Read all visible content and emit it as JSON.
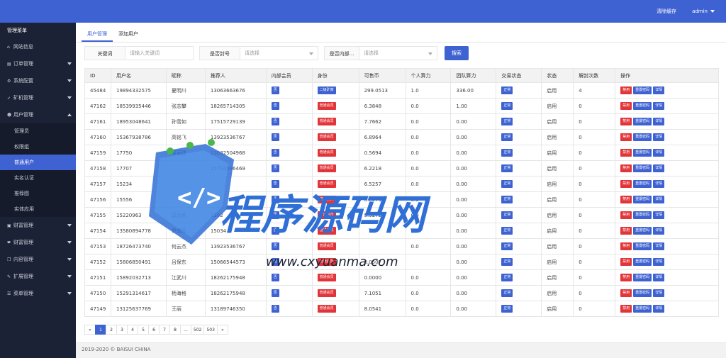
{
  "header": {
    "clear_cache": "清除缓存",
    "user": "admin"
  },
  "sidebar": {
    "title": "管理菜单",
    "items": [
      {
        "label": "网站信息",
        "icon": "home-icon",
        "glyph": "⌂",
        "arrow": false
      },
      {
        "label": "订单管理",
        "icon": "order-icon",
        "glyph": "▤",
        "arrow": true
      },
      {
        "label": "系统配置",
        "icon": "gear-icon",
        "glyph": "⚙",
        "arrow": true
      },
      {
        "label": "矿机管理",
        "icon": "rocket-icon",
        "glyph": "➶",
        "arrow": true
      },
      {
        "label": "用户管理",
        "icon": "users-icon",
        "glyph": "☻",
        "arrow": true,
        "expanded": true
      }
    ],
    "sub_items": [
      "管理员",
      "权限组",
      "普通用户",
      "实名认证",
      "推荐图",
      "实体应用"
    ],
    "active_sub": "普通用户",
    "items_after": [
      {
        "label": "财富管理",
        "icon": "wallet-icon",
        "glyph": "▣",
        "arrow": true
      },
      {
        "label": "财富管理",
        "icon": "coin-icon",
        "glyph": "❤",
        "arrow": true
      },
      {
        "label": "内容管理",
        "icon": "file-icon",
        "glyph": "❐",
        "arrow": true
      },
      {
        "label": "扩展管理",
        "icon": "wrench-icon",
        "glyph": "✎",
        "arrow": true
      },
      {
        "label": "菜单管理",
        "icon": "menu-icon",
        "glyph": "☰",
        "arrow": true
      }
    ]
  },
  "tabs": [
    "用户管理",
    "添加用户"
  ],
  "filters": {
    "keyword_label": "关键词",
    "keyword_placeholder": "请输入关键词",
    "frozen_label": "是否封号",
    "frozen_placeholder": "请选择",
    "internal_label": "是否内部...",
    "internal_placeholder": "请选择",
    "search_button": "搜索"
  },
  "table": {
    "columns": [
      "ID",
      "用户名",
      "昵称",
      "推荐人",
      "内部会员",
      "身份",
      "可售币",
      "个人算力",
      "团队算力",
      "交易状态",
      "状态",
      "解封次数",
      "操作"
    ],
    "actions": [
      "禁用",
      "重置密码",
      "详情"
    ],
    "rows": [
      [
        "45484",
        "19894332575",
        "夏明川",
        "13063663676",
        "否",
        "二级矿商",
        "299.0513",
        "1.0",
        "336.00",
        "正常",
        "启用",
        "4"
      ],
      [
        "47162",
        "18539935446",
        "张志攀",
        "18265714305",
        "否",
        "普通会员",
        "6.3848",
        "0.0",
        "1.00",
        "正常",
        "启用",
        "0"
      ],
      [
        "47161",
        "18953048641",
        "孙雪如",
        "17515729139",
        "否",
        "普通会员",
        "7.7662",
        "0.0",
        "0.00",
        "正常",
        "启用",
        "0"
      ],
      [
        "47160",
        "15367938786",
        "高铭飞",
        "13923536767",
        "否",
        "普通会员",
        "6.8964",
        "0.0",
        "0.00",
        "正常",
        "启用",
        "0"
      ],
      [
        "47159",
        "17750",
        "吴丽建",
        "13032504968",
        "否",
        "普通会员",
        "0.5694",
        "0.0",
        "0.00",
        "正常",
        "启用",
        "0"
      ],
      [
        "47158",
        "17707",
        "",
        "15724596469",
        "否",
        "普通会员",
        "6.2218",
        "0.0",
        "0.00",
        "正常",
        "启用",
        "0"
      ],
      [
        "47157",
        "15234",
        "",
        "",
        "否",
        "普通会员",
        "6.5257",
        "0.0",
        "0.00",
        "正常",
        "启用",
        "0"
      ],
      [
        "47156",
        "15556",
        "",
        "",
        "否",
        "普通会员",
        "6.6279",
        "0.0",
        "0.00",
        "正常",
        "启用",
        "0"
      ],
      [
        "47155",
        "15220963",
        "莫功武",
        "1392",
        "否",
        "普通会员",
        "5.9272",
        "0.0",
        "0.00",
        "正常",
        "启用",
        "0"
      ],
      [
        "47154",
        "13580894778",
        "罗成亮",
        "15034",
        "否",
        "普通会员",
        "",
        "0.0",
        "0.00",
        "正常",
        "启用",
        "0"
      ],
      [
        "47153",
        "18726473740",
        "何云杰",
        "13923536767",
        "否",
        "普通会员",
        "",
        "0.0",
        "0.00",
        "正常",
        "启用",
        "0"
      ],
      [
        "47152",
        "15806850491",
        "吕保东",
        "15066544573",
        "否",
        "普通会员",
        "0.0507",
        "",
        "0.00",
        "正常",
        "启用",
        "0"
      ],
      [
        "47151",
        "15892032713",
        "江武川",
        "18262175948",
        "否",
        "普通会员",
        "0.0000",
        "0.0",
        "0.00",
        "正常",
        "启用",
        "0"
      ],
      [
        "47150",
        "15291314617",
        "杨海格",
        "18262175948",
        "否",
        "普通会员",
        "7.1051",
        "0.0",
        "0.00",
        "正常",
        "启用",
        "0"
      ],
      [
        "47149",
        "13125637769",
        "王丽",
        "13189746350",
        "否",
        "普通会员",
        "8.0541",
        "0.0",
        "0.00",
        "正常",
        "启用",
        "0"
      ]
    ]
  },
  "pagination": [
    "«",
    "1",
    "2",
    "3",
    "4",
    "5",
    "6",
    "7",
    "8",
    "...",
    "502",
    "503",
    "»"
  ],
  "pagination_active": "1",
  "footer": "2019-2020 © BAISUI CHINA",
  "watermark": {
    "text": "程序源码网",
    "url": "www.cxyuanma.com"
  },
  "colors": {
    "primary": "#3f62d2",
    "danger": "#e2353a",
    "sidebar": "#1c2235"
  }
}
